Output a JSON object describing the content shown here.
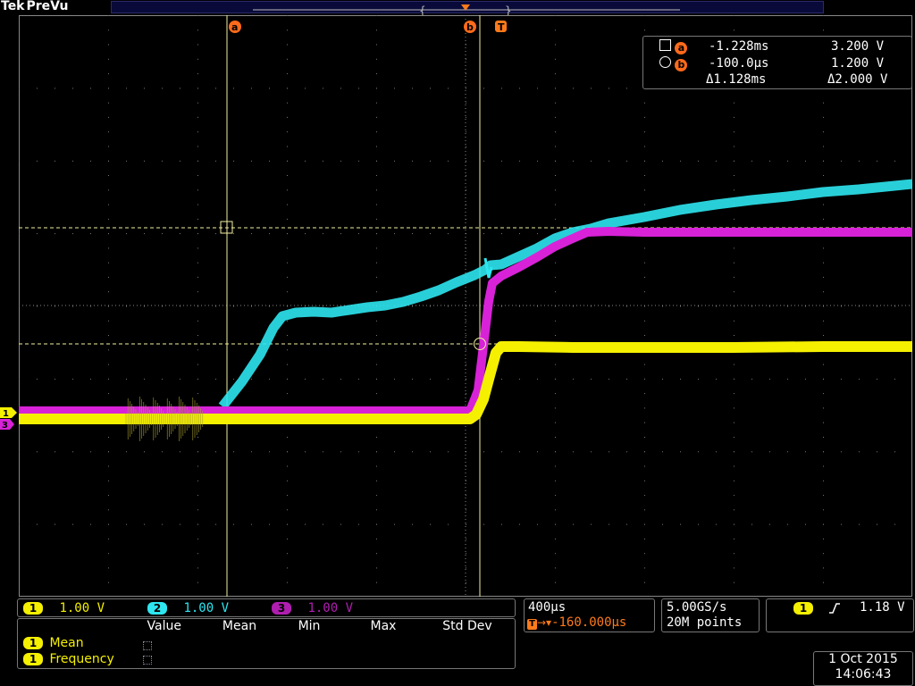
{
  "brand": {
    "maker": "Tek",
    "mode": "PreVu"
  },
  "cursors": {
    "a": {
      "label": "a",
      "time": "-1.228ms",
      "volt": "3.200 V"
    },
    "b": {
      "label": "b",
      "time": "-100.0µs",
      "volt": "1.200 V"
    },
    "delta_time": "Δ1.128ms",
    "delta_volt": "Δ2.000 V"
  },
  "trigger_marker": "T",
  "channels": [
    {
      "num": "1",
      "scale": "1.00 V",
      "color": "#f5f000"
    },
    {
      "num": "2",
      "scale": "1.00 V",
      "color": "#2ee6f0"
    },
    {
      "num": "3",
      "scale": "1.00 V",
      "color": "#d822d8"
    }
  ],
  "ground_markers": {
    "ch1": "1",
    "ch3": "3"
  },
  "timebase": {
    "scale": "400µs",
    "position": "-160.000µs"
  },
  "acquisition": {
    "rate": "5.00GS/s",
    "record": "20M points"
  },
  "trigger": {
    "source": "1",
    "slope_icon": "rising-edge-icon",
    "level": "1.18 V"
  },
  "measurements": {
    "columns": [
      "Value",
      "Mean",
      "Min",
      "Max",
      "Std Dev"
    ],
    "rows": [
      {
        "source": "1",
        "name": "Mean"
      },
      {
        "source": "1",
        "name": "Frequency"
      }
    ]
  },
  "datetime": {
    "date": "1 Oct 2015",
    "time": "14:06:43"
  },
  "colors": {
    "ch1": "#f5f000",
    "ch2": "#2ee6f0",
    "ch3": "#d822d8",
    "cursor": "#ff7a1a",
    "grid": "#7a7a7a"
  }
}
